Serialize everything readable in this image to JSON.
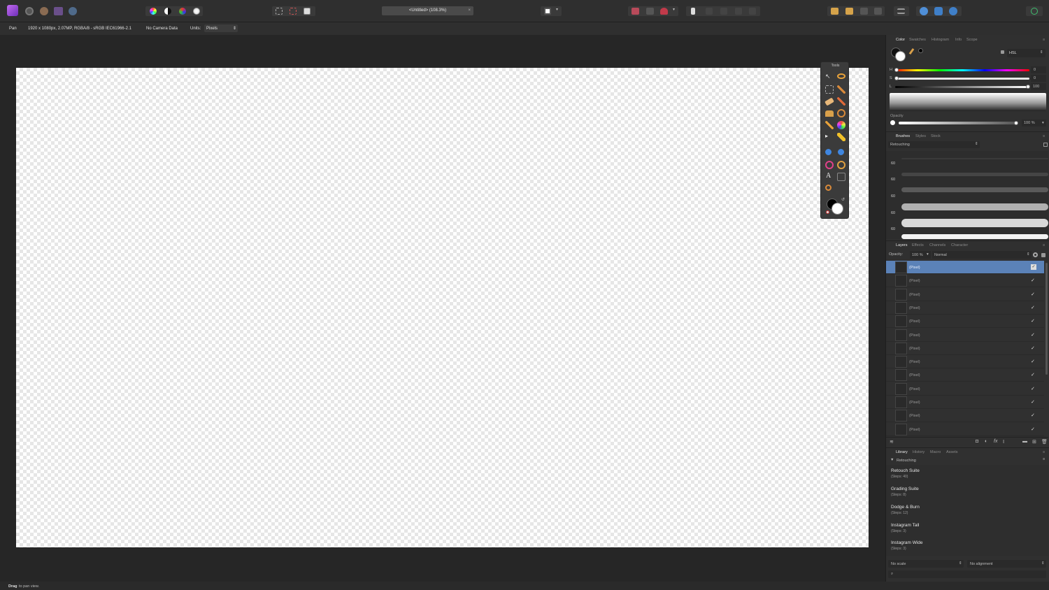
{
  "toolbar": {
    "document_title": "<Untitled> (108.3%)"
  },
  "context": {
    "tool_name": "Pan",
    "doc_info": "1920 x 1080px, 2.07MP, RGBA/8 - sRGB IEC61966-2.1",
    "camera": "No Camera Data",
    "units_label": "Units:",
    "units_value": "Pixels"
  },
  "tools_panel": {
    "title": "Tools"
  },
  "color_panel": {
    "tabs": [
      "Color",
      "Swatches",
      "Histogram",
      "Info",
      "Scope"
    ],
    "mode": "HSL",
    "h_label": "H",
    "h_value": "0",
    "s_label": "S",
    "s_value": "0",
    "l_label": "L",
    "l_value": "100",
    "opacity_label": "Opacity",
    "opacity_value": "100 %"
  },
  "brushes_panel": {
    "tabs": [
      "Brushes",
      "Styles",
      "Stock"
    ],
    "category": "Retouching",
    "sizes": [
      "60",
      "60",
      "60",
      "60",
      "60"
    ]
  },
  "layers_panel": {
    "tabs": [
      "Layers",
      "Effects",
      "Channels",
      "Character"
    ],
    "opacity_label": "Opacity:",
    "opacity_value": "100 %",
    "blend_mode": "Normal",
    "layers": [
      "(Pixel)",
      "(Pixel)",
      "(Pixel)",
      "(Pixel)",
      "(Pixel)",
      "(Pixel)",
      "(Pixel)",
      "(Pixel)",
      "(Pixel)",
      "(Pixel)",
      "(Pixel)",
      "(Pixel)",
      "(Pixel)"
    ],
    "selected_index": 0
  },
  "library_panel": {
    "tabs": [
      "Library",
      "History",
      "Macro",
      "Assets"
    ],
    "category": "Retouching",
    "macros": [
      {
        "name": "Retouch Suite",
        "steps": "(Steps: 40)"
      },
      {
        "name": "Grading Suite",
        "steps": "(Steps: 8)"
      },
      {
        "name": "Dodge & Burn",
        "steps": "(Steps: 12)"
      },
      {
        "name": "Instagram Tall",
        "steps": "(Steps: 3)"
      },
      {
        "name": "Instagram Wide",
        "steps": "(Steps: 3)"
      }
    ],
    "scale_value": "No scale",
    "alignment_value": "No alignment"
  },
  "status": {
    "bold": "Drag",
    "text": "to pan view."
  },
  "colors": {
    "accent": "#5b82b8",
    "app_icon": "#9b4fd6"
  }
}
